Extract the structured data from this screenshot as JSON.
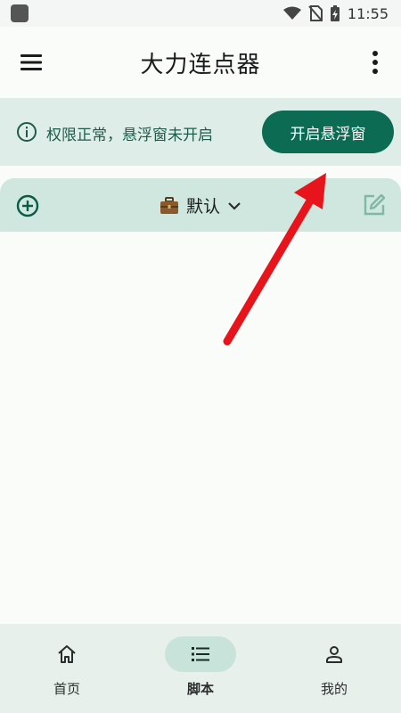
{
  "status_bar": {
    "time": "11:55"
  },
  "app_bar": {
    "title": "大力连点器"
  },
  "banner": {
    "message": "权限正常，悬浮窗未开启",
    "button_label": "开启悬浮窗"
  },
  "group_bar": {
    "group_name": "默认"
  },
  "bottom_nav": {
    "items": [
      {
        "label": "首页",
        "icon": "home-icon"
      },
      {
        "label": "脚本",
        "icon": "list-icon",
        "selected": true
      },
      {
        "label": "我的",
        "icon": "person-icon"
      }
    ]
  },
  "colors": {
    "accent": "#0b6b53",
    "banner_bg": "#dfede8",
    "group_bar_bg": "#cfe7de",
    "annotation_arrow": "#e8141c"
  }
}
